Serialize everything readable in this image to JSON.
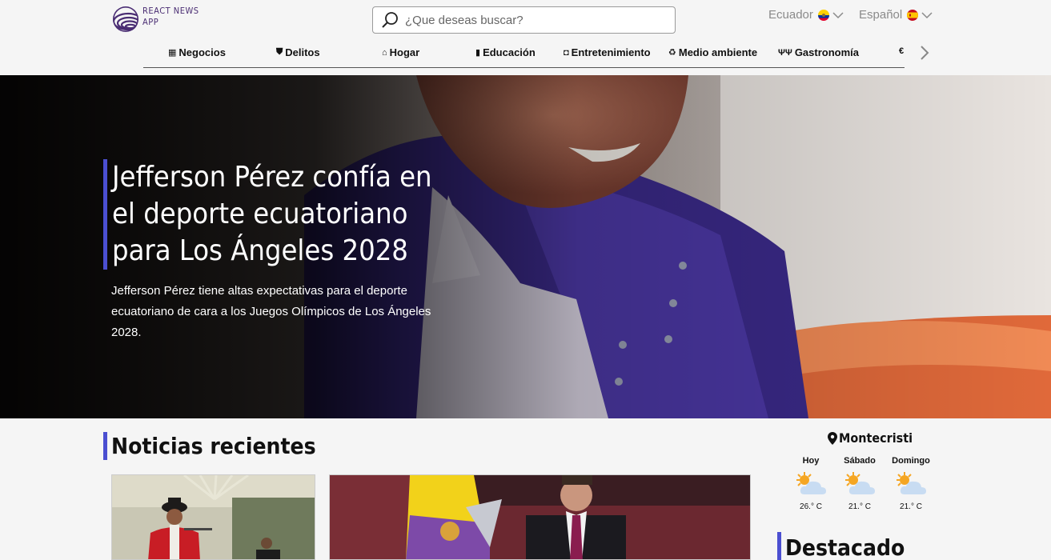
{
  "header": {
    "logo_line1": "REACT NEWS",
    "logo_line2": "APP",
    "search_placeholder": "¿Que deseas buscar?",
    "country": "Ecuador",
    "language": "Español"
  },
  "nav": {
    "items": [
      {
        "label": "Negocios",
        "icon": "building-icon"
      },
      {
        "label": "Delitos",
        "icon": "badge-icon"
      },
      {
        "label": "Hogar",
        "icon": "home-icon"
      },
      {
        "label": "Educación",
        "icon": "book-icon"
      },
      {
        "label": "Entretenimiento",
        "icon": "gamepad-icon"
      },
      {
        "label": "Medio ambiente",
        "icon": "recycle-icon"
      },
      {
        "label": "Gastronomía",
        "icon": "utensils-icon"
      }
    ]
  },
  "hero": {
    "title": "Jefferson Pérez confía en el deporte ecuatoriano para Los Ángeles 2028",
    "subtitle": "Jefferson Pérez tiene altas expectativas para el deporte ecuatoriano de cara a los Juegos Olímpicos de Los Ángeles 2028."
  },
  "recent": {
    "title": "Noticias recientes"
  },
  "weather": {
    "location": "Montecristi",
    "days": [
      {
        "name": "Hoy",
        "temp": "26.° C"
      },
      {
        "name": "Sábado",
        "temp": "21.° C"
      },
      {
        "name": "Domingo",
        "temp": "21.° C"
      }
    ]
  },
  "featured": {
    "title": "Destacado"
  },
  "colors": {
    "accent": "#4b4fd1",
    "logo": "#4a2d73"
  }
}
